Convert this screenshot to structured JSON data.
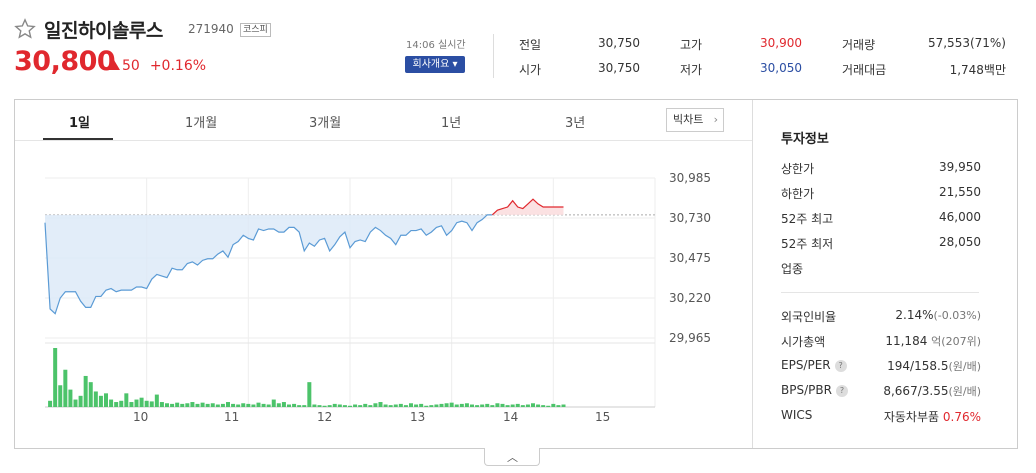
{
  "stock": {
    "name": "일진하이솔루스",
    "code": "271940",
    "market": "코스피",
    "price": "30,800",
    "change": "50",
    "change_pct": "+0.16%",
    "realtime": "14:06 실시간",
    "corp_button": "회사개요 ▾"
  },
  "stats": {
    "prev_label": "전일",
    "prev": "30,750",
    "open_label": "시가",
    "open": "30,750",
    "high_label": "고가",
    "high": "30,900",
    "low_label": "저가",
    "low": "30,050",
    "volume_label": "거래량",
    "volume": "57,553(71%)",
    "amount_label": "거래대금",
    "amount": "1,748백만"
  },
  "tabs": [
    "1일",
    "1개월",
    "3개월",
    "1년",
    "3년"
  ],
  "big_chart_label": "빅차트",
  "chart_data": {
    "type": "line",
    "title": "",
    "xlabel": "",
    "ylabel": "",
    "y_ticks": [
      "30,985",
      "30,730",
      "30,475",
      "30,220",
      "29,965"
    ],
    "x_ticks": [
      "10",
      "11",
      "12",
      "13",
      "14",
      "15"
    ],
    "ylim": [
      29965,
      30985
    ],
    "xlim": [
      9.0,
      15.5
    ],
    "baseline": 30750,
    "price_x": [
      9.0,
      9.05,
      9.1,
      9.15,
      9.2,
      9.25,
      9.3,
      9.35,
      9.4,
      9.45,
      9.5,
      9.55,
      9.6,
      9.65,
      9.7,
      9.75,
      9.8,
      9.85,
      9.9,
      9.95,
      10.0,
      10.05,
      10.1,
      10.15,
      10.2,
      10.25,
      10.3,
      10.35,
      10.4,
      10.45,
      10.5,
      10.55,
      10.6,
      10.65,
      10.7,
      10.75,
      10.8,
      10.85,
      10.9,
      10.95,
      11.0,
      11.05,
      11.1,
      11.15,
      11.2,
      11.25,
      11.3,
      11.35,
      11.4,
      11.45,
      11.5,
      11.55,
      11.6,
      11.65,
      11.7,
      11.75,
      11.8,
      11.85,
      11.9,
      11.95,
      12.0,
      12.05,
      12.1,
      12.15,
      12.2,
      12.25,
      12.3,
      12.35,
      12.4,
      12.45,
      12.5,
      12.55,
      12.6,
      12.65,
      12.7,
      12.75,
      12.8,
      12.85,
      12.9,
      12.95,
      13.0,
      13.05,
      13.1,
      13.15,
      13.2,
      13.25,
      13.3,
      13.35,
      13.4,
      13.45,
      13.5,
      13.55,
      13.6,
      13.65,
      13.7,
      13.75,
      13.8,
      13.85,
      13.9,
      13.95,
      14.0,
      14.05,
      14.1
    ],
    "price_y": [
      30700,
      30150,
      30120,
      30220,
      30260,
      30260,
      30260,
      30200,
      30160,
      30160,
      30230,
      30230,
      30270,
      30280,
      30260,
      30270,
      30270,
      30270,
      30290,
      30290,
      30280,
      30340,
      30370,
      30360,
      30350,
      30410,
      30400,
      30400,
      30440,
      30450,
      30430,
      30460,
      30470,
      30470,
      30500,
      30520,
      30480,
      30560,
      30580,
      30620,
      30600,
      30590,
      30660,
      30650,
      30660,
      30660,
      30640,
      30640,
      30670,
      30670,
      30640,
      30520,
      30570,
      30550,
      30590,
      30600,
      30520,
      30560,
      30610,
      30640,
      30540,
      30580,
      30590,
      30580,
      30640,
      30670,
      30650,
      30620,
      30600,
      30560,
      30620,
      30620,
      30650,
      30650,
      30660,
      30620,
      30640,
      30670,
      30680,
      30620,
      30650,
      30700,
      30710,
      30700,
      30650,
      30700,
      30720,
      30750,
      30750,
      30780,
      30790,
      30800,
      30840,
      30800,
      30790,
      30820,
      30850,
      30820,
      30800,
      30800,
      30800,
      30800,
      30800
    ],
    "volume_x": [
      9.05,
      9.1,
      9.15,
      9.2,
      9.25,
      9.3,
      9.35,
      9.4,
      9.45,
      9.5,
      9.55,
      9.6,
      9.65,
      9.7,
      9.75,
      9.8,
      9.85,
      9.9,
      9.95,
      10.0,
      10.05,
      10.1,
      10.15,
      10.2,
      10.25,
      10.3,
      10.35,
      10.4,
      10.45,
      10.5,
      10.55,
      10.6,
      10.65,
      10.7,
      10.75,
      10.8,
      10.85,
      10.9,
      10.95,
      11.0,
      11.05,
      11.1,
      11.15,
      11.2,
      11.25,
      11.3,
      11.35,
      11.4,
      11.45,
      11.5,
      11.55,
      11.6,
      11.65,
      11.7,
      11.75,
      11.8,
      11.85,
      11.9,
      11.95,
      12.0,
      12.05,
      12.1,
      12.15,
      12.2,
      12.25,
      12.3,
      12.35,
      12.4,
      12.45,
      12.5,
      12.55,
      12.6,
      12.65,
      12.7,
      12.75,
      12.8,
      12.85,
      12.9,
      12.95,
      13.0,
      13.05,
      13.1,
      13.15,
      13.2,
      13.25,
      13.3,
      13.35,
      13.4,
      13.45,
      13.5,
      13.55,
      13.6,
      13.65,
      13.7,
      13.75,
      13.8,
      13.85,
      13.9,
      13.95,
      14.0,
      14.05,
      14.1
    ],
    "volume": [
      10,
      95,
      35,
      60,
      28,
      12,
      18,
      50,
      40,
      25,
      18,
      22,
      12,
      8,
      10,
      22,
      8,
      12,
      15,
      10,
      9,
      20,
      8,
      6,
      5,
      7,
      5,
      6,
      8,
      5,
      7,
      5,
      6,
      4,
      5,
      8,
      5,
      4,
      6,
      5,
      4,
      7,
      5,
      4,
      12,
      6,
      8,
      4,
      5,
      3,
      3,
      40,
      4,
      3,
      2,
      3,
      5,
      4,
      3,
      2,
      4,
      3,
      5,
      3,
      6,
      8,
      4,
      3,
      4,
      5,
      3,
      6,
      4,
      5,
      2,
      3,
      4,
      5,
      6,
      7,
      4,
      5,
      6,
      4,
      3,
      4,
      5,
      3,
      6,
      5,
      3,
      4,
      5,
      3,
      4,
      6,
      4,
      3,
      2,
      5,
      3,
      4
    ]
  },
  "side": {
    "title": "투자정보",
    "upper_label": "상한가",
    "upper": "39,950",
    "lower_label": "하한가",
    "lower": "21,550",
    "high52_label": "52주 최고",
    "high52": "46,000",
    "low52_label": "52주 최저",
    "low52": "28,050",
    "sector_label": "업종",
    "foreign_label": "외국인비율",
    "foreign": "2.14%",
    "foreign_chg": "(-0.03%)",
    "cap_label": "시가총액",
    "cap": "11,184",
    "cap_unit": "억(207위)",
    "eps_label": "EPS/PER",
    "eps": "194/158.5",
    "eps_unit": "(원/배)",
    "bps_label": "BPS/PBR",
    "bps": "8,667/3.55",
    "bps_unit": "(원/배)",
    "wics_label": "WICS",
    "wics": "자동차부품",
    "wics_pct": "0.76%"
  },
  "colors": {
    "up": "#e0282e",
    "down": "#2b4ea3",
    "line": "#5b9bd5",
    "fill": "#dbe8f7",
    "volume": "#4cc36a"
  }
}
